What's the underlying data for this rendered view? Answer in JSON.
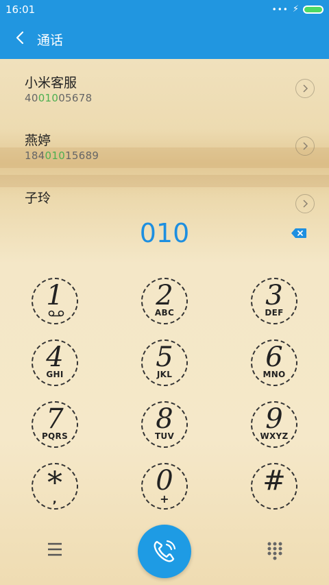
{
  "status_bar": {
    "time": "16:01"
  },
  "app_bar": {
    "title": "通话"
  },
  "results": [
    {
      "name": "小米客服",
      "number_pre": "40",
      "number_match": "010",
      "number_post": "05678"
    },
    {
      "name": "燕婷",
      "number_pre": "184",
      "number_match": "010",
      "number_post": "15689"
    },
    {
      "name": "子玲"
    }
  ],
  "dialed": "010",
  "keys": [
    {
      "digit": "1",
      "letters": ""
    },
    {
      "digit": "2",
      "letters": "ABC"
    },
    {
      "digit": "3",
      "letters": "DEF"
    },
    {
      "digit": "4",
      "letters": "GHI"
    },
    {
      "digit": "5",
      "letters": "JKL"
    },
    {
      "digit": "6",
      "letters": "MNO"
    },
    {
      "digit": "7",
      "letters": "PQRS"
    },
    {
      "digit": "8",
      "letters": "TUV"
    },
    {
      "digit": "9",
      "letters": "WXYZ"
    },
    {
      "digit": "*",
      "letters": ","
    },
    {
      "digit": "0",
      "letters": "+"
    },
    {
      "digit": "#",
      "letters": ""
    }
  ],
  "colors": {
    "accent": "#2196e0",
    "match_highlight": "#4caf50",
    "call_button": "#1e9be4"
  }
}
